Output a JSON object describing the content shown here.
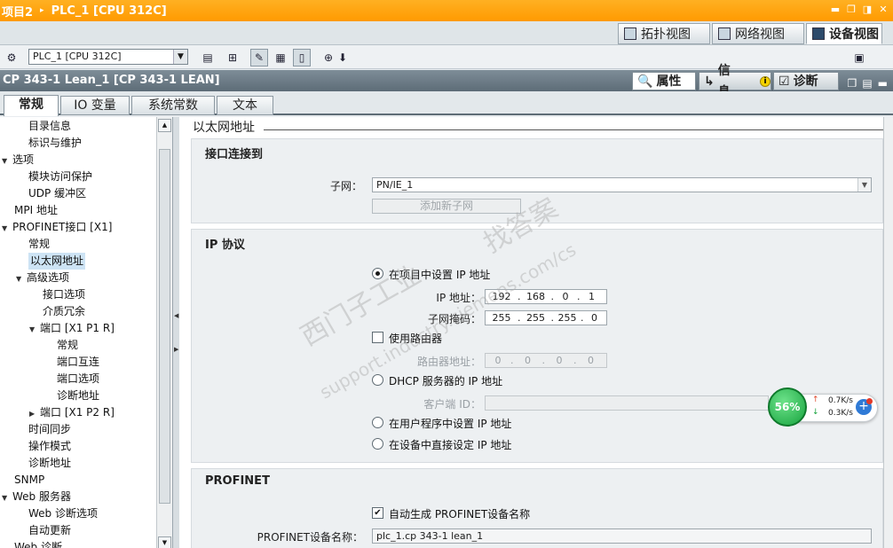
{
  "titlebar": {
    "project": "项目2",
    "separator": "▸",
    "device": "PLC_1 [CPU 312C]"
  },
  "views": [
    {
      "label": "拓扑视图",
      "icon": "topology-icon"
    },
    {
      "label": "网络视图",
      "icon": "network-icon"
    },
    {
      "label": "设备视图",
      "icon": "device-icon",
      "active": true
    }
  ],
  "toolbar": {
    "device_select": "PLC_1 [CPU 312C]"
  },
  "inspector": {
    "title": "CP 343-1 Lean_1 [CP 343-1 LEAN]",
    "tabs": [
      {
        "label": "属性",
        "active": true
      },
      {
        "label": "信息",
        "badge": "i"
      },
      {
        "label": "诊断"
      }
    ]
  },
  "subtabs": [
    {
      "label": "常规",
      "active": true
    },
    {
      "label": "IO 变量"
    },
    {
      "label": "系统常数"
    },
    {
      "label": "文本"
    }
  ],
  "tree": [
    {
      "label": "目录信息",
      "level": 2
    },
    {
      "label": "标识与维护",
      "level": 2
    },
    {
      "label": "选项",
      "level": 0,
      "toggle": "expanded"
    },
    {
      "label": "模块访问保护",
      "level": 2
    },
    {
      "label": "UDP 缓冲区",
      "level": 2
    },
    {
      "label": "MPI 地址",
      "level": 1
    },
    {
      "label": "PROFINET接口 [X1]",
      "level": 0,
      "toggle": "expanded"
    },
    {
      "label": "常规",
      "level": 2
    },
    {
      "label": "以太网地址",
      "level": 2,
      "selected": true
    },
    {
      "label": "高级选项",
      "level": 1.5,
      "toggle": "expanded"
    },
    {
      "label": "接口选项",
      "level": 3
    },
    {
      "label": "介质冗余",
      "level": 3
    },
    {
      "label": "端口 [X1 P1 R]",
      "level": 2.5,
      "toggle": "expanded"
    },
    {
      "label": "常规",
      "level": 4
    },
    {
      "label": "端口互连",
      "level": 4
    },
    {
      "label": "端口选项",
      "level": 4
    },
    {
      "label": "诊断地址",
      "level": 4
    },
    {
      "label": "端口 [X1 P2 R]",
      "level": 2.5,
      "toggle": "collapsed"
    },
    {
      "label": "时间同步",
      "level": 2
    },
    {
      "label": "操作模式",
      "level": 2
    },
    {
      "label": "诊断地址",
      "level": 2
    },
    {
      "label": "SNMP",
      "level": 1
    },
    {
      "label": "Web 服务器",
      "level": 0,
      "toggle": "expanded"
    },
    {
      "label": "Web 诊断选项",
      "level": 2
    },
    {
      "label": "自动更新",
      "level": 2
    },
    {
      "label": "Web 诊断",
      "level": 1
    }
  ],
  "main": {
    "section_title": "以太网地址",
    "interface": {
      "title": "接口连接到",
      "subnet_label": "子网：",
      "subnet_value": "PN/IE_1",
      "add_subnet": "添加新子网"
    },
    "ip": {
      "title": "IP 协议",
      "opt_project": "在项目中设置 IP 地址",
      "ip_label": "IP 地址：",
      "ip_value": [
        "192",
        "168",
        "0",
        "1"
      ],
      "mask_label": "子网掩码：",
      "mask_value": [
        "255",
        "255",
        "255",
        "0"
      ],
      "use_router": "使用路由器",
      "router_label": "路由器地址：",
      "router_value": [
        "0",
        "0",
        "0",
        "0"
      ],
      "opt_dhcp": "DHCP 服务器的 IP 地址",
      "client_id_label": "客户端 ID：",
      "opt_user": "在用户程序中设置 IP 地址",
      "opt_device": "在设备中直接设定 IP 地址"
    },
    "profinet": {
      "title": "PROFINET",
      "auto_name": "自动生成 PROFINET设备名称",
      "name_label": "PROFINET设备名称：",
      "name_value": "plc_1.cp 343-1 lean_1"
    }
  },
  "net_widget": {
    "percent": "56%",
    "up": "0.7K/s",
    "down": "0.3K/s",
    "up_arrow": "↑",
    "down_arrow": "↓",
    "plus": "+"
  },
  "watermark": {
    "line1": "西门子工业",
    "line2": "support.industry.siemens.com/cs",
    "line3": "找答案"
  },
  "colors": {
    "title_orange": "#ff9a00",
    "inspector_header": "#6b7a85",
    "selection": "#cde3f4",
    "net_green": "#17a33e"
  }
}
